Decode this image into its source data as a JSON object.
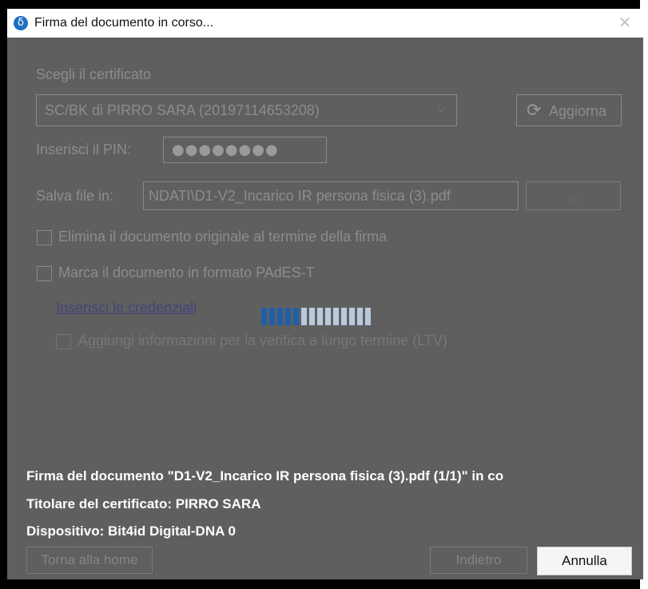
{
  "window": {
    "app_icon_glyph": "δ",
    "title": "Firma del documento in corso...",
    "close_glyph": "✕"
  },
  "certificate": {
    "label": "Scegli il certificato",
    "selected": "SC/BK di PIRRO SARA (20197114653208)",
    "chevron_glyph": "⌵",
    "refresh_icon_glyph": "⟳",
    "refresh_label": "Aggiorna"
  },
  "pin": {
    "label": "Inserisci il PIN:",
    "masked_value": "●●●●●●●●"
  },
  "save_file": {
    "label": "Salva file in:",
    "value": "NDATI\\D1-V2_Incarico IR persona fisica (3).pdf",
    "browse_label": "..."
  },
  "options": {
    "delete_original": {
      "label": "Elimina il documento originale al termine della firma",
      "checked": false
    },
    "pades_t": {
      "label": "Marca il documento in formato PAdES-T",
      "checked": false
    },
    "credentials_link": "Inserisci le credenziali",
    "ltv": {
      "label": "Aggiungi informazioni per la verifica a lungo termine (LTV)",
      "checked": false
    }
  },
  "progress": {
    "segments_total": 14,
    "segments_active": 5
  },
  "status": {
    "line1": "Firma del documento \"D1-V2_Incarico IR persona fisica (3).pdf (1/1)\" in co",
    "line2": "Titolare del certificato: PIRRO SARA",
    "line3": "Dispositivo: Bit4id Digital-DNA 0"
  },
  "footer": {
    "home_label": "Torna alla home",
    "back_label": "Indietro",
    "cancel_label": "Annulla"
  },
  "colors": {
    "overlay_gray": "#5f5f5f",
    "progress_active": "#1f5fa8",
    "progress_inactive": "#b9c9dc",
    "app_icon": "#1e6fc4"
  }
}
